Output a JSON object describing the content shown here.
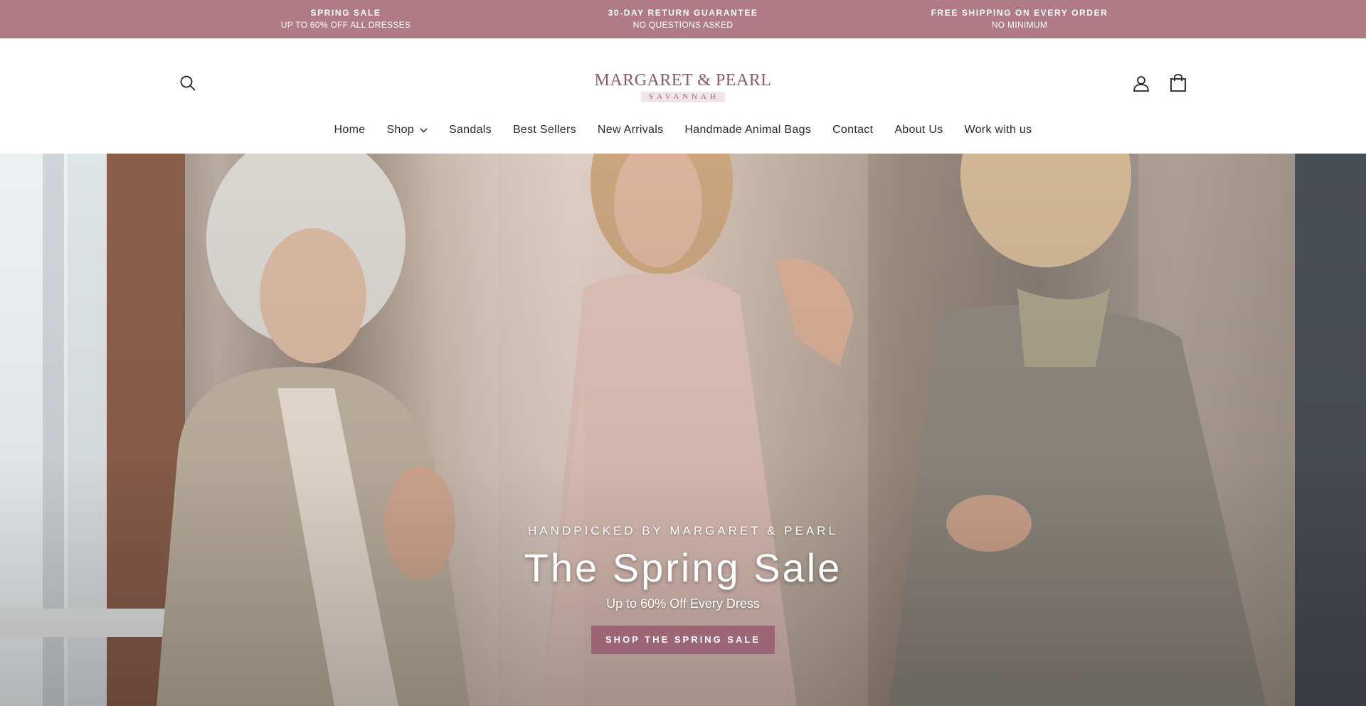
{
  "announcement": [
    {
      "title": "SPRING SALE",
      "subtitle": "UP TO 60% OFF ALL DRESSES"
    },
    {
      "title": "30-DAY RETURN GUARANTEE",
      "subtitle": "NO QUESTIONS ASKED"
    },
    {
      "title": "FREE SHIPPING ON EVERY ORDER",
      "subtitle": "NO MINIMUM"
    }
  ],
  "header": {
    "logo_main": "MARGARET & PEARL",
    "logo_sub": "SAVANNAH",
    "icons": [
      "search-icon",
      "account-icon",
      "cart-icon"
    ]
  },
  "nav": {
    "items": [
      {
        "label": "Home"
      },
      {
        "label": "Shop",
        "has_dropdown": true
      },
      {
        "label": "Sandals"
      },
      {
        "label": "Best Sellers"
      },
      {
        "label": "New Arrivals"
      },
      {
        "label": "Handmade Animal Bags"
      },
      {
        "label": "Contact"
      },
      {
        "label": "About Us"
      },
      {
        "label": "Work with us"
      }
    ]
  },
  "hero": {
    "kicker": "HANDPICKED BY MARGARET & PEARL",
    "title": "The Spring Sale",
    "subtitle": "Up to 60% Off Every Dress",
    "cta_label": "SHOP THE SPRING SALE"
  },
  "colors": {
    "announcement_bg": "#b07a87",
    "brand": "#8a5a68",
    "cta_bg": "#9c6677"
  }
}
